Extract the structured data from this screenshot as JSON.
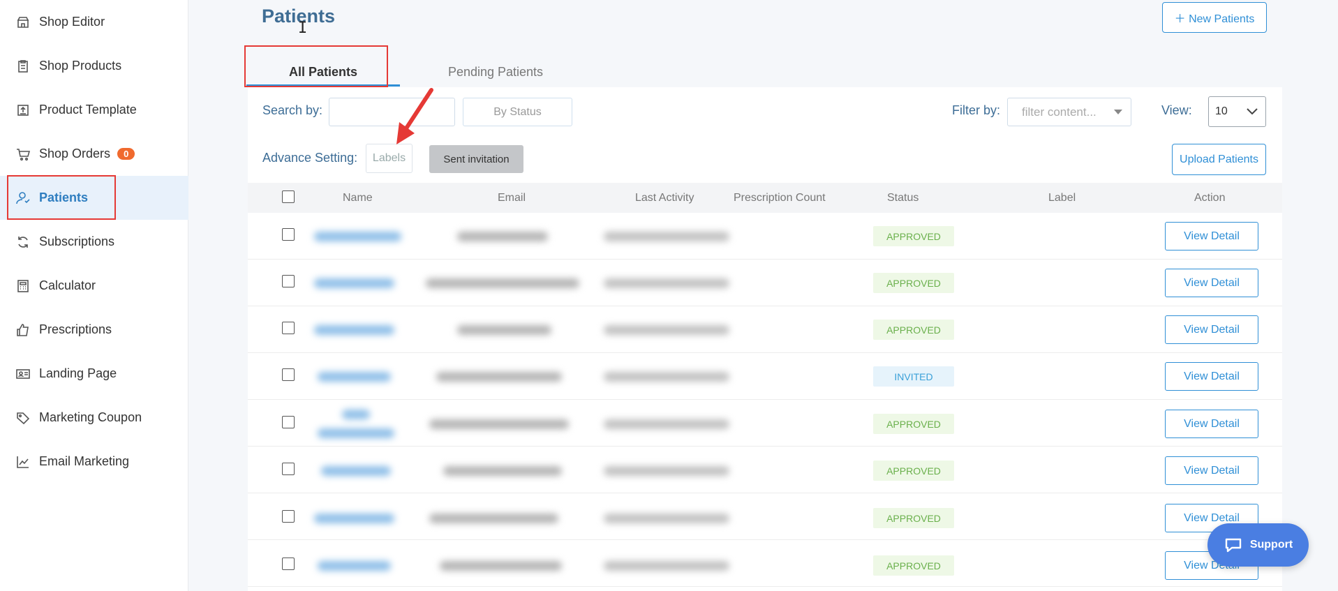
{
  "sidebar": {
    "items": [
      {
        "label": "Shop Editor",
        "icon": "store-icon"
      },
      {
        "label": "Shop Products",
        "icon": "clipboard-icon"
      },
      {
        "label": "Product Template",
        "icon": "template-icon"
      },
      {
        "label": "Shop Orders",
        "icon": "cart-icon",
        "badge": "0"
      },
      {
        "label": "Patients",
        "icon": "user-icon",
        "active": true
      },
      {
        "label": "Subscriptions",
        "icon": "refresh-icon"
      },
      {
        "label": "Calculator",
        "icon": "calculator-icon"
      },
      {
        "label": "Prescriptions",
        "icon": "thumbs-up-icon"
      },
      {
        "label": "Landing Page",
        "icon": "id-card-icon"
      },
      {
        "label": "Marketing Coupon",
        "icon": "tag-icon"
      },
      {
        "label": "Email Marketing",
        "icon": "chart-line-icon"
      }
    ]
  },
  "header": {
    "title": "Patients",
    "new_button": "＋ New Patients"
  },
  "tabs": [
    {
      "label": "All Patients",
      "active": true
    },
    {
      "label": "Pending Patients"
    }
  ],
  "toolbar": {
    "search_label": "Search by:",
    "search_value": "",
    "status_select": "By Status",
    "filter_label": "Filter by:",
    "filter_placeholder": "filter content...",
    "view_label": "View:",
    "view_value": "10",
    "advance_label": "Advance Setting:",
    "labels_button": "Labels",
    "sent_invitation_button": "Sent invitation",
    "upload_button": "Upload Patients"
  },
  "table": {
    "columns": [
      "Name",
      "Email",
      "Last Activity",
      "Prescription Count",
      "Status",
      "Label",
      "Action"
    ],
    "rows": [
      {
        "status": "APPROVED",
        "action": "View Detail"
      },
      {
        "status": "APPROVED",
        "action": "View Detail"
      },
      {
        "status": "APPROVED",
        "action": "View Detail"
      },
      {
        "status": "INVITED",
        "action": "View Detail"
      },
      {
        "status": "APPROVED",
        "action": "View Detail"
      },
      {
        "status": "APPROVED",
        "action": "View Detail"
      },
      {
        "status": "APPROVED",
        "action": "View Detail"
      },
      {
        "status": "APPROVED",
        "action": "View Detail"
      }
    ]
  },
  "support": {
    "label": "Support"
  },
  "colors": {
    "accent": "#2f8fd6",
    "badge": "#f06a2e",
    "highlight": "#e53935",
    "approved": "#6ab04c",
    "invited": "#3aa0d8"
  }
}
